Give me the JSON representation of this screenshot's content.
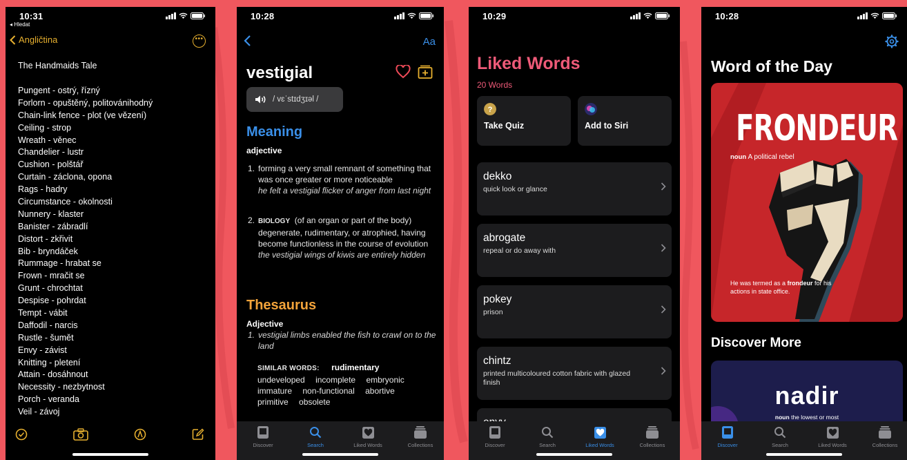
{
  "notes": {
    "time": "10:31",
    "back_app": "◂ Hledat",
    "back_label": "Angličtina",
    "title": "The Handmaids Tale",
    "entries": [
      "Pungent - ostrý, řízný",
      "Forlorn - opuštěný, politovánihodný",
      "Chain-link fence - plot (ve vězení)",
      "Ceiling - strop",
      "Wreath - věnec",
      "Chandelier - lustr",
      "Cushion - polštář",
      "Curtain - záclona, opona",
      "Rags - hadry",
      "Circumstance - okolnosti",
      "Nunnery - klaster",
      "Banister - zábradlí",
      "Distort - zkřivit",
      "Bib - bryndáček",
      "Rummage - hrabat se",
      "Frown - mračit se",
      "Grunt - chrochtat",
      "Despise - pohrdat",
      "Tempt - vábit",
      "Daffodil - narcis",
      "Rustle - šumět",
      "Envy - závist",
      "Knitting - pletení",
      "Attain - dosáhnout",
      "Necessity - nezbytnost",
      "Porch - veranda",
      "Veil - závoj"
    ]
  },
  "dictionary": {
    "time": "10:28",
    "font_button": "Aa",
    "word": "vestigial",
    "pronunciation": "/ vɛˈstɪdʒɪəl /",
    "meaning_heading": "Meaning",
    "meaning_pos": "adjective",
    "def1_num": "1.",
    "def1_text": "forming a very small remnant of something that was once greater or more noticeable",
    "def1_example": "he felt a vestigial flicker of anger from last night",
    "def2_num": "2.",
    "def2_domain": "BIOLOGY",
    "def2_text": "(of an organ or part of the body) degenerate, rudimentary, or atrophied, having become functionless in the course of evolution",
    "def2_example": "the vestigial wings of kiwis are entirely hidden",
    "thesaurus_heading": "Thesaurus",
    "thesaurus_pos": "Adjective",
    "thesaurus_num": "1.",
    "thesaurus_example": "vestigial limbs enabled the fish to crawl on to the land",
    "similar_label": "SIMILAR WORDS:",
    "similar_words": [
      "rudimentary",
      "undeveloped",
      "incomplete",
      "embryonic",
      "immature",
      "non-functional",
      "abortive",
      "primitive",
      "obsolete"
    ],
    "accent_blue": "#3a8fe8",
    "accent_orange": "#f2a33a",
    "accent_red": "#ee4a58"
  },
  "liked": {
    "time": "10:29",
    "title": "Liked Words",
    "count": "20 Words",
    "quiz_label": "Take Quiz",
    "siri_label": "Add to Siri",
    "words": [
      {
        "word": "dekko",
        "meaning": "quick look or glance"
      },
      {
        "word": "abrogate",
        "meaning": "repeal or do away with"
      },
      {
        "word": "pokey",
        "meaning": "prison"
      },
      {
        "word": "chintz",
        "meaning": "printed multicoloured cotton fabric with glazed finish"
      },
      {
        "word": "envy",
        "meaning": ""
      }
    ],
    "accent_pink": "#ee5a78"
  },
  "discover": {
    "time": "10:28",
    "title": "Word of the Day",
    "wotd_word": "FRONDEUR",
    "wotd_pos": "noun",
    "wotd_def": "A political rebel",
    "caption_pre": "He was termed as a ",
    "caption_word": "frondeur",
    "caption_post": " for his actions in state office.",
    "discover_more": "Discover More",
    "more_word": "nadir",
    "more_pos": "noun",
    "more_def": "the lowest or most",
    "card_red": "#c6262a"
  },
  "tabs": {
    "discover": "Discover",
    "search": "Search",
    "liked": "Liked Words",
    "collections": "Collections"
  }
}
